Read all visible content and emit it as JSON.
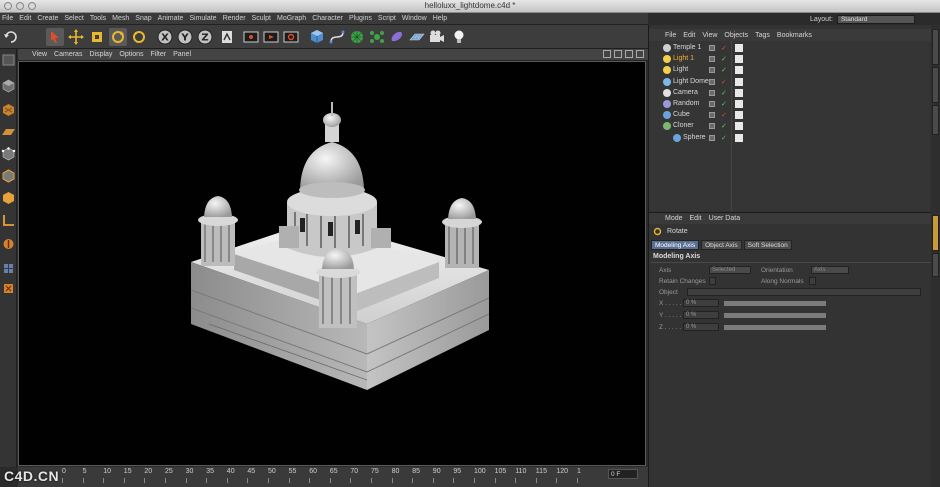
{
  "window": {
    "title": "helloluxx_lightdome.c4d *"
  },
  "menubar": {
    "items": [
      "File",
      "Edit",
      "Create",
      "Select",
      "Tools",
      "Mesh",
      "Snap",
      "Animate",
      "Simulate",
      "Render",
      "Sculpt",
      "MoGraph",
      "Character",
      "Plugins",
      "Script",
      "Window",
      "Help"
    ]
  },
  "layout": {
    "label": "Layout:",
    "value": "Standard"
  },
  "viewport": {
    "menu": [
      "View",
      "Cameras",
      "Display",
      "Options",
      "Filter",
      "Panel"
    ]
  },
  "timeline": {
    "ticks": [
      "0",
      "5",
      "10",
      "15",
      "20",
      "25",
      "30",
      "35",
      "40",
      "45",
      "50",
      "55",
      "60",
      "65",
      "70",
      "75",
      "80",
      "85",
      "90",
      "95",
      "100",
      "105",
      "110",
      "115",
      "120",
      "1"
    ],
    "frame": "0 F"
  },
  "watermark": "C4D.CN",
  "object_manager": {
    "menu": [
      "File",
      "Edit",
      "View",
      "Objects",
      "Tags",
      "Bookmarks"
    ],
    "objects": [
      {
        "name": "Temple 1",
        "selected": false,
        "indent": 0
      },
      {
        "name": "Light 1",
        "selected": true,
        "indent": 0
      },
      {
        "name": "Light",
        "selected": false,
        "indent": 0
      },
      {
        "name": "Light Dome",
        "selected": false,
        "indent": 0
      },
      {
        "name": "Camera",
        "selected": false,
        "indent": 0
      },
      {
        "name": "Random",
        "selected": false,
        "indent": 0
      },
      {
        "name": "Cube",
        "selected": false,
        "indent": 0
      },
      {
        "name": "Cloner",
        "selected": false,
        "indent": 0
      },
      {
        "name": "Sphere",
        "selected": false,
        "indent": 1
      }
    ]
  },
  "attribute_manager": {
    "menu": [
      "Mode",
      "Edit",
      "User Data"
    ],
    "tool": "Rotate",
    "tabs": [
      "Modeling Axis",
      "Object Axis",
      "Soft Selection"
    ],
    "section": "Modeling Axis",
    "fields": {
      "axis_label": "Axis",
      "axis_value": "Selected",
      "orientation_label": "Orientation",
      "orientation_value": "Axis",
      "retain_label": "Retain Changes",
      "along_normals_label": "Along Normals",
      "object_label": "Object",
      "x_label": "X . . . . .",
      "y_label": "Y . . . . .",
      "z_label": "Z . . . . .",
      "x_value": "0 %",
      "y_value": "0 %",
      "z_value": "0 %"
    }
  },
  "colors": {
    "selected_text": "#f2b43a",
    "active_tab": "#5a6f94",
    "viewport_bg": "#010101"
  }
}
